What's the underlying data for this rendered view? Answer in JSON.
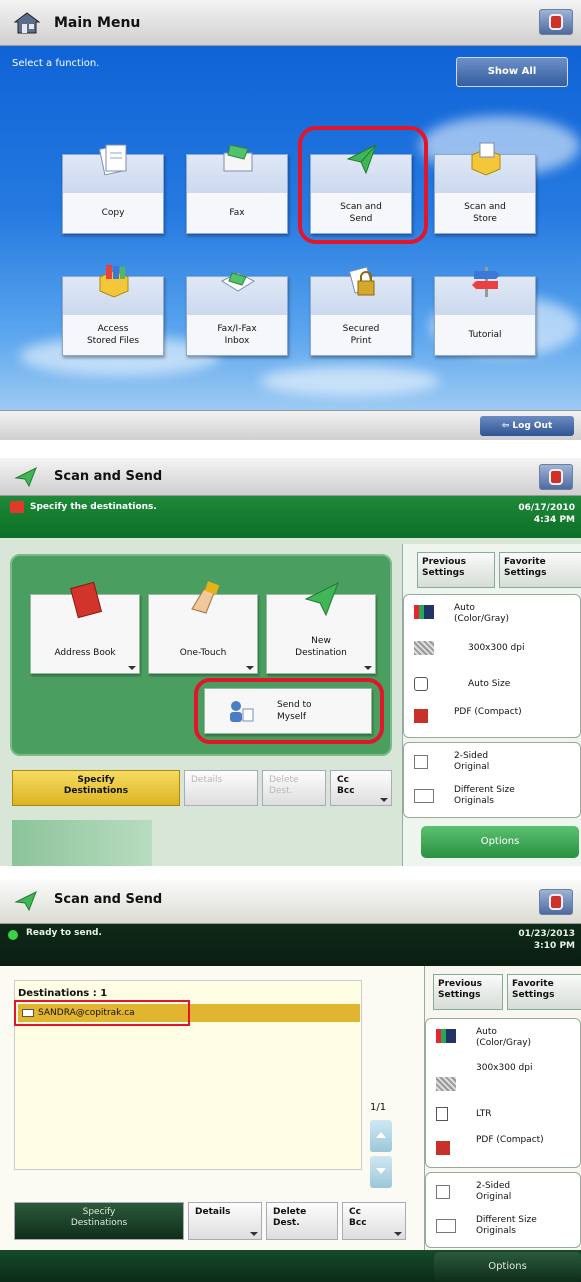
{
  "main_menu": {
    "title": "Main Menu",
    "prompt": "Select a function.",
    "show_all": "Show All",
    "log_out": "Log Out",
    "tiles": [
      {
        "label": "Copy"
      },
      {
        "label": "Fax"
      },
      {
        "label": "Scan and\nSend"
      },
      {
        "label": "Scan and\nStore"
      },
      {
        "label": "Access\nStored Files"
      },
      {
        "label": "Fax/I-Fax\nInbox"
      },
      {
        "label": "Secured\nPrint"
      },
      {
        "label": "Tutorial"
      }
    ]
  },
  "scan_send_1": {
    "title": "Scan and Send",
    "message": "Specify the destinations.",
    "date": "06/17/2010",
    "time": "4:34 PM",
    "buttons": {
      "address_book": "Address Book",
      "one_touch": "One-Touch",
      "new_destination": "New\nDestination",
      "send_to_myself": "Send to\nMyself"
    },
    "tabs": {
      "specify": "Specify\nDestinations",
      "details": "Details",
      "delete": "Delete\nDest.",
      "cc_bcc": "Cc\nBcc"
    },
    "side": {
      "previous": "Previous\nSettings",
      "favorite": "Favorite\nSettings",
      "color": "Auto\n(Color/Gray)",
      "resolution": "300x300 dpi",
      "size": "Auto Size",
      "format": "PDF (Compact)",
      "sided": "2-Sided\nOriginal",
      "diff_size": "Different Size\nOriginals",
      "options": "Options"
    }
  },
  "scan_send_2": {
    "title": "Scan and Send",
    "message": "Ready to send.",
    "date": "01/23/2013",
    "time": "3:10 PM",
    "destinations_label": "Destinations",
    "destinations_count": ":  1",
    "destination_entry": "SANDRA@copitrak.ca",
    "page": "1/1",
    "tabs": {
      "specify": "Specify\nDestinations",
      "details": "Details",
      "delete": "Delete\nDest.",
      "cc_bcc": "Cc\nBcc"
    },
    "side": {
      "previous": "Previous\nSettings",
      "favorite": "Favorite\nSettings",
      "color": "Auto\n(Color/Gray)",
      "resolution": "300x300 dpi",
      "size": "LTR",
      "format": "PDF (Compact)",
      "sided": "2-Sided\nOriginal",
      "diff_size": "Different Size\nOriginals",
      "options": "Options"
    }
  }
}
